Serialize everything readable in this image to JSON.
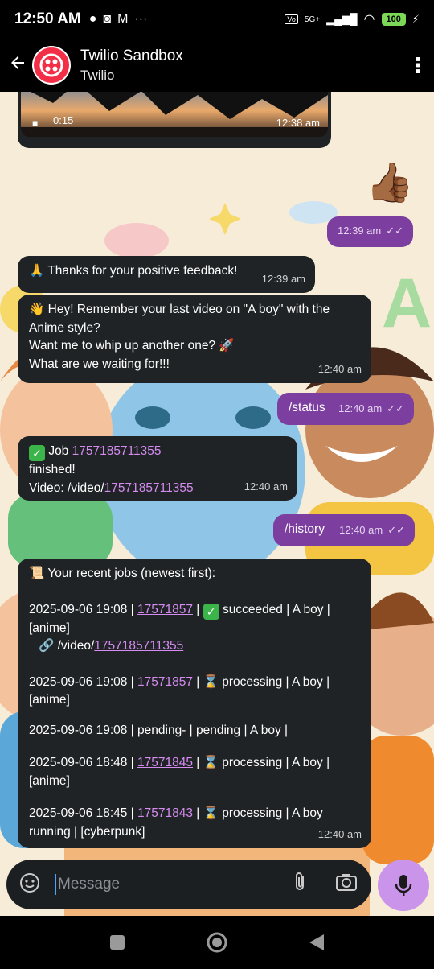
{
  "statusbar": {
    "time": "12:50 AM",
    "network": "5G+",
    "battery": "100"
  },
  "header": {
    "title": "Twilio Sandbox",
    "subtitle": "Twilio"
  },
  "messages": {
    "image_msg": {
      "duration": "0:15",
      "time": "12:38 am"
    },
    "thumbs_up": {
      "emoji": "👍🏾"
    },
    "out1": {
      "time": "12:39 am"
    },
    "in1": {
      "emoji": "🙏",
      "text": "Thanks for your positive feedback!",
      "time": "12:39 am"
    },
    "in2": {
      "emoji": "👋",
      "line1": "Hey! Remember your last video on \"A boy\" with the",
      "line2": "Anime style?",
      "line3": "Want me to whip up another one? 🚀",
      "line4": "What are we waiting for!!!",
      "time": "12:40 am"
    },
    "out2": {
      "text": "/status",
      "time": "12:40 am"
    },
    "in3": {
      "prefix": "Job",
      "job_id": "1757185711355",
      "line2": "finished!",
      "video_prefix": "Video: /video/",
      "video_id": "1757185711355",
      "time": "12:40 am"
    },
    "out3": {
      "text": "/history",
      "time": "12:40 am"
    },
    "in4": {
      "emoji": "📜",
      "header": "Your recent jobs (newest first):",
      "job1_date": "2025-09-06 19:08 |",
      "job1_id": "17571857",
      "job1_status": "succeeded | A boy |",
      "job1_style": "[anime]",
      "job1_link_prefix": "/video/",
      "job1_link_id": "1757185711355",
      "job2_date": "2025-09-06 19:08 |",
      "job2_id": "17571857",
      "job2_status": "processing | A boy |",
      "job2_style": "[anime]",
      "job3_line": "2025-09-06 19:08 | pending- |  pending | A boy |",
      "job4_date": "2025-09-06 18:48 |",
      "job4_id": "17571845",
      "job4_status": "processing | A boy |",
      "job4_style": "[anime]",
      "job5_date": "2025-09-06 18:45 |",
      "job5_id": "17571843",
      "job5_status": "processing | A boy",
      "job5_line2": "running |  [cyberpunk]",
      "time": "12:40 am"
    }
  },
  "composer": {
    "placeholder": "Message"
  },
  "colors": {
    "incoming_bubble": "#1f2326",
    "outgoing_bubble": "#7c3fa0",
    "link": "#d58bf0",
    "mic_button": "#c994ea"
  }
}
